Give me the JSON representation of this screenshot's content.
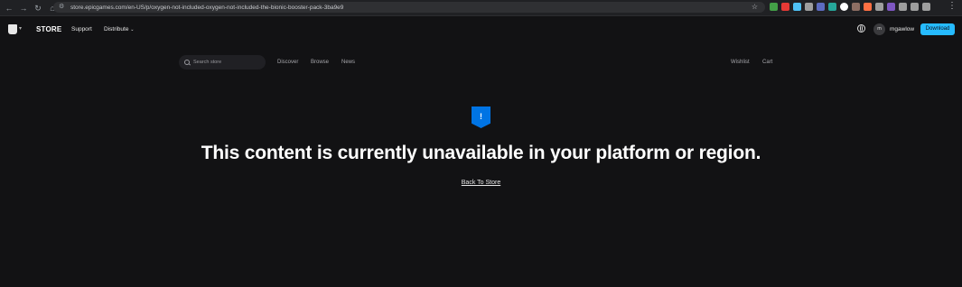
{
  "browser": {
    "url": "store.epicgames.com/en-US/p/oxygen-not-included-oxygen-not-included-the-bionic-booster-pack-3ba9e9",
    "back_icon": "arrow-left-icon",
    "forward_icon": "arrow-right-icon",
    "reload_icon": "reload-icon",
    "home_icon": "home-icon",
    "extensions_colors": [
      "#43a047",
      "#e53935",
      "#4fc3f7",
      "#9e9e9e",
      "#5c6bc0",
      "#26a69a",
      "#ffffff",
      "#8d6e63",
      "#ff7043",
      "#9e9e9e",
      "#7e57c2",
      "#9e9e9e",
      "#9e9e9e",
      "#9e9e9e"
    ]
  },
  "nav": {
    "store_label": "STORE",
    "support": "Support",
    "distribute": "Distribute",
    "username_initials": "m",
    "username": "mgawlow",
    "download": "Download"
  },
  "subnav": {
    "search_placeholder": "Search store",
    "discover": "Discover",
    "browse": "Browse",
    "news": "News",
    "wishlist": "Wishlist",
    "cart": "Cart"
  },
  "main": {
    "badge_glyph": "!",
    "headline": "This content is currently unavailable in your platform or region.",
    "back_link": "Back To Store"
  },
  "colors": {
    "background": "#121214",
    "accent": "#26bbff",
    "badge": "#0074e4"
  }
}
